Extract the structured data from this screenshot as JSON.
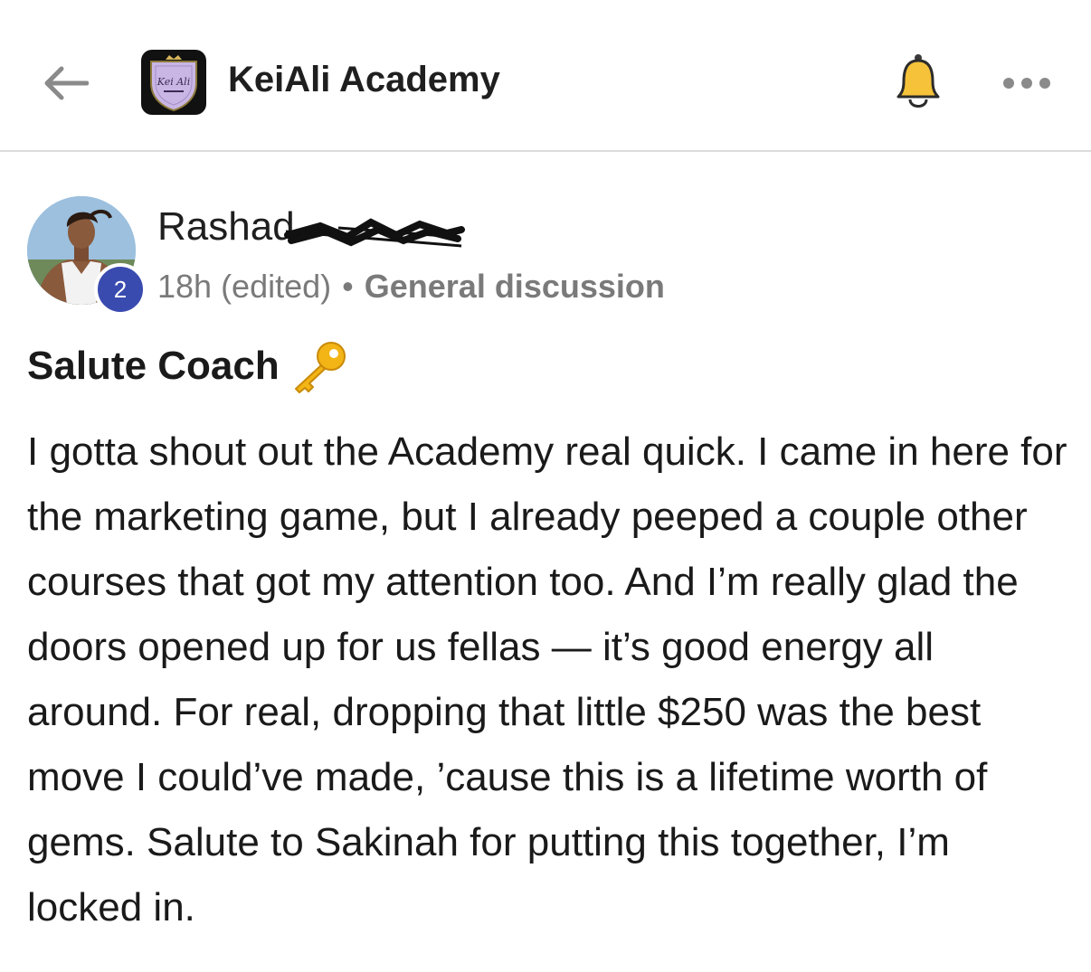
{
  "header": {
    "back_icon": "arrow-left-icon",
    "group_logo_text": "Kei Ali",
    "group_name": "KeiAli Academy",
    "bell_icon": "bell-icon",
    "more_icon": "more-horizontal-icon"
  },
  "post": {
    "author": {
      "name": "Rashad",
      "level": "2"
    },
    "time": "18h (edited)",
    "separator": "•",
    "category": "General discussion",
    "title": "Salute Coach",
    "title_emoji": "key-emoji-icon",
    "body": "I gotta shout out the Academy real quick. I came in here for the marketing game, but I already peeped a couple other courses that got my attention too. And I’m really glad the doors opened up for us fellas — it’s good energy all around. For real, dropping that little $250 was the best move I could’ve made, ’cause this is a lifetime worth of gems. Salute to Sakinah for putting this together, I’m locked in."
  },
  "colors": {
    "level_badge": "#3a4bb0",
    "bell": "#f5c23a",
    "meta_text": "#7a7a7a",
    "logo_bg": "#111111",
    "logo_shield": "#c9b6e4"
  }
}
